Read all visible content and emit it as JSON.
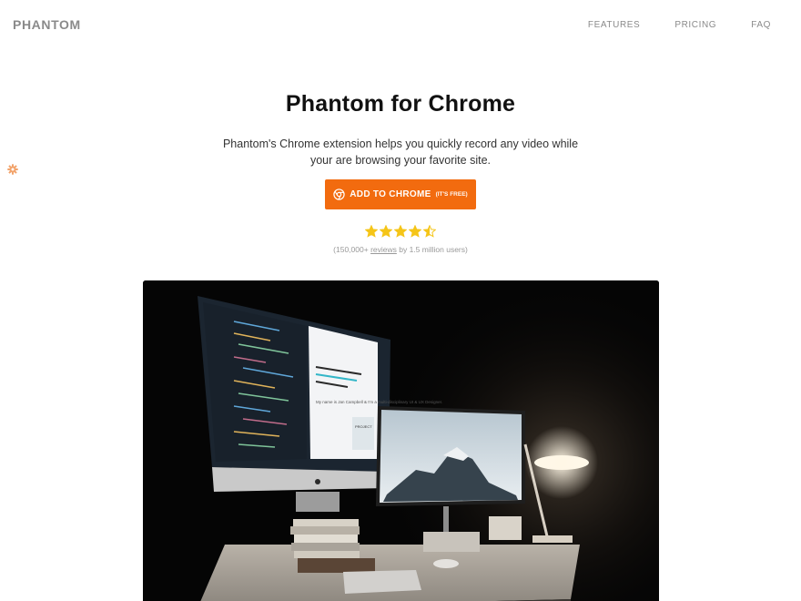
{
  "nav": {
    "brand": "PHANTOM",
    "links": [
      "FEATURES",
      "PRICING",
      "FAQ"
    ]
  },
  "hero": {
    "title": "Phantom for Chrome",
    "subtitle": "Phantom's Chrome extension helps you quickly record any video while your are browsing your favorite site."
  },
  "cta": {
    "label": "ADD TO CHROME",
    "note": "(IT'S FREE)",
    "icon": "chrome-icon",
    "color": "#f26b0f"
  },
  "rating": {
    "stars": 4.5,
    "max": 5,
    "prefix": "(150,000+",
    "link": "reviews",
    "suffix": "by 1.5 million users)",
    "star_color": "#f5c518"
  },
  "widget": {
    "icon": "gear-icon",
    "color": "#f2a36b"
  },
  "image": {
    "screen_text": "My name is Jan Campbell & I'm a multi-disciplinary UI & UX Designer.",
    "card_text": "PROJECT"
  }
}
